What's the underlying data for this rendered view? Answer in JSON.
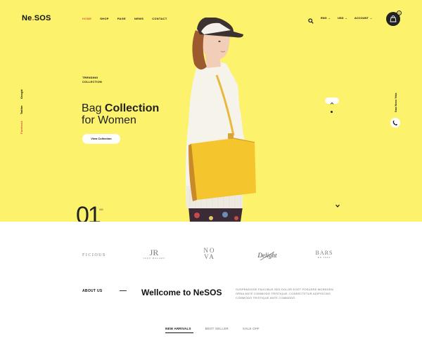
{
  "header": {
    "logo_main": "Ne",
    "logo_dot": ".",
    "logo_rest": "SOS",
    "nav": [
      "HOME",
      "SHOP",
      "PAGE",
      "NEWS",
      "CONTACT"
    ],
    "currency": "ENG",
    "language": "USD",
    "account": "ACCOUNT",
    "cart_count": "0"
  },
  "social": [
    "Facebook",
    "Twitter",
    "Google"
  ],
  "hero": {
    "trending_line1": "TRENDING",
    "trending_line2": "COLLECTION",
    "headline_light": "Bag ",
    "headline_bold": "Collection",
    "headline_line2": "for Women",
    "cta": "View Collection",
    "slide_number": "01",
    "slide_total": "/05",
    "phone": "Sna Noss Yola"
  },
  "brands": {
    "b1": "FICIOUS",
    "b2_big": "JR",
    "b2_small": "JACK RALLEN",
    "b3_line1": "NO",
    "b3_line2": "VA",
    "b4": "Delight",
    "b5_big": "BARS",
    "b5_small": "ES 1961"
  },
  "about": {
    "label": "ABOUT US",
    "title": "Wellcome to NeSOS",
    "text": "SUSPENDISSE FAUCIBUS SED DOLOR EGET POSUERE MOREDEM ORNA ANTE COMMODO TRISTIQUE. CONSECTETUR ADIPISCING COMMODO TRISTIQUE ANTE COMMODO"
  },
  "tabs": [
    "NEW ARRIVALS",
    "BEST SELLER",
    "SALE OFF"
  ],
  "colors": {
    "hero_bg": "#fcf26b",
    "accent": "#e0543a",
    "dark": "#222222"
  }
}
